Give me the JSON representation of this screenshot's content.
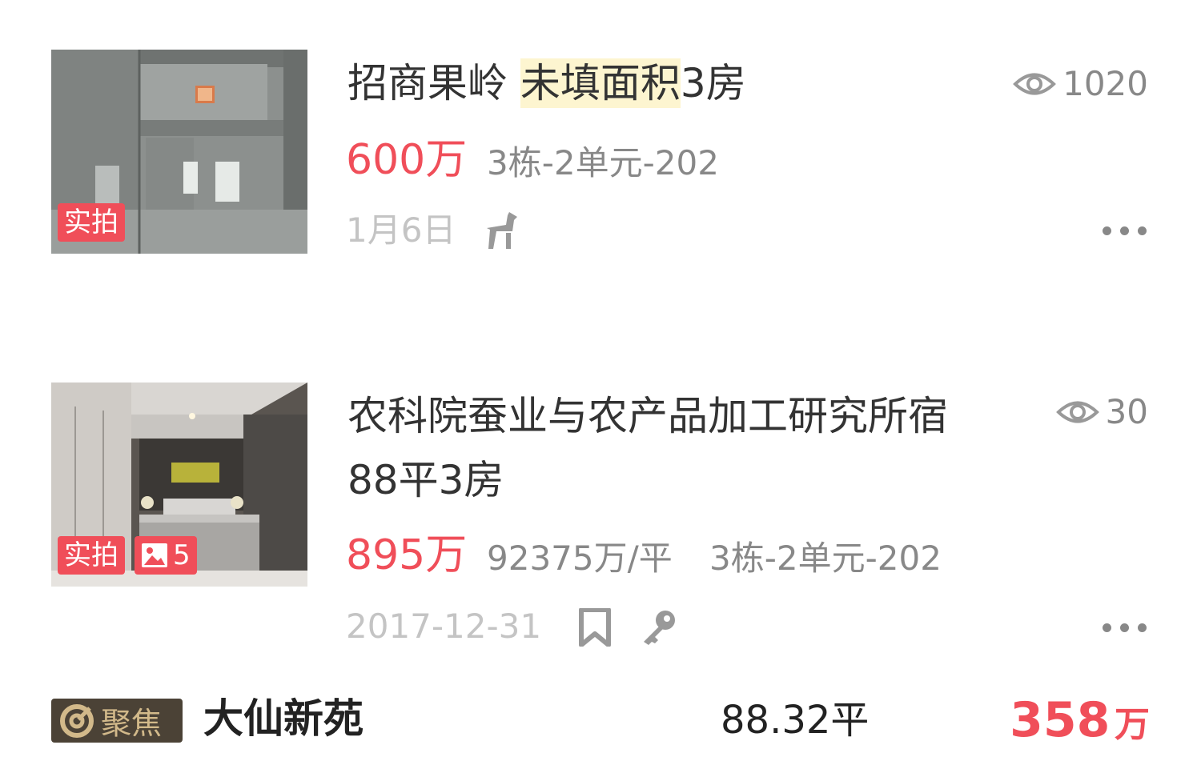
{
  "listings": [
    {
      "title_prefix": "招商果岭",
      "title_highlight": "未填面积",
      "title_suffix": "3房",
      "views": "1020",
      "price": "600万",
      "address": "3栋-2单元-202",
      "date": "1月6日",
      "tag": "实拍"
    },
    {
      "title_line1": "农科院蚕业与农产品加工研究所宿",
      "title_line2": "88平3房",
      "views": "30",
      "price": "895万",
      "unit_price": "92375万/平",
      "address": "3栋-2单元-202",
      "date": "2017-12-31",
      "tag": "实拍",
      "photo_count": "5"
    }
  ],
  "featured": {
    "badge": "聚焦",
    "name": "大仙新苑",
    "area": "88.32平",
    "price_value": "358",
    "price_unit": "万"
  },
  "colors": {
    "accent": "#f04e59",
    "muted": "#888888",
    "faint": "#c4c4c4",
    "highlight": "#fdf5d0"
  },
  "icons": [
    "eye-icon",
    "giraffe-icon",
    "bookmark-icon",
    "key-icon",
    "more-icon",
    "image-icon",
    "focus-icon"
  ]
}
